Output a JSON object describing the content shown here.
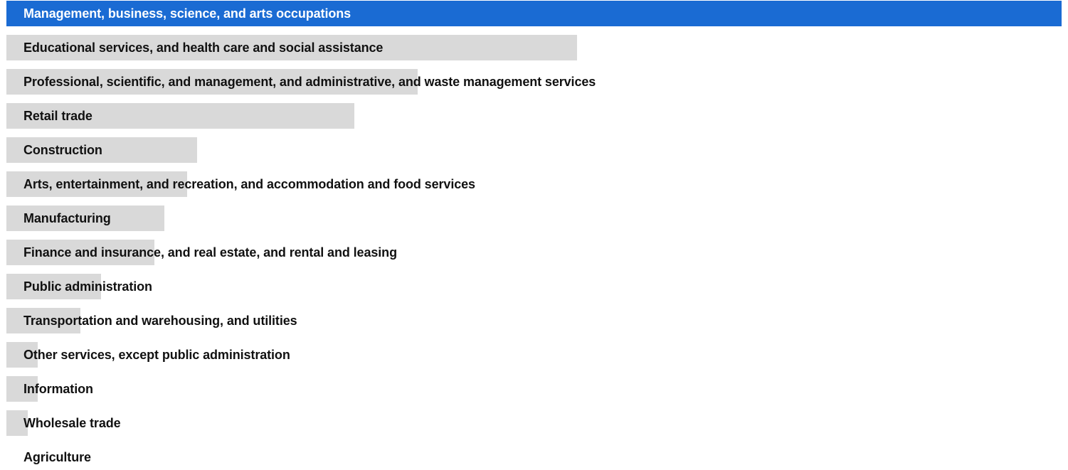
{
  "chart_data": {
    "type": "bar",
    "orientation": "horizontal",
    "categories": [
      "Management, business, science, and arts occupations",
      "Educational services, and health care and social assistance",
      "Professional, scientific, and management, and administrative, and waste management services",
      "Retail trade",
      "Construction",
      "Arts, entertainment, and recreation, and accommodation and food services",
      "Manufacturing",
      "Finance and insurance, and real estate, and rental and leasing",
      "Public administration",
      "Transportation and warehousing, and utilities",
      "Other services, except public administration",
      "Information",
      "Wholesale trade",
      "Agriculture"
    ],
    "values": [
      100,
      54.1,
      39.0,
      33.0,
      18.1,
      17.1,
      15.0,
      14.0,
      9.0,
      7.0,
      3.0,
      3.0,
      2.0,
      0
    ],
    "value_scale": "relative (percent of largest bar)",
    "selected_index": 0,
    "colors": {
      "bar": "#d9d9d9",
      "selected_bar": "#1a6bd3",
      "label": "#111111",
      "selected_label": "#ffffff"
    },
    "grid": false,
    "legend": "none"
  }
}
